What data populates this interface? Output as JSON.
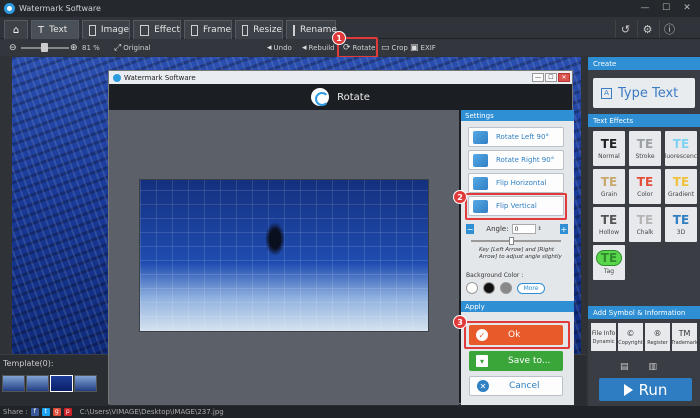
{
  "window": {
    "title": "Watermark Software"
  },
  "tabs": [
    {
      "label": "Text"
    },
    {
      "label": "Image"
    },
    {
      "label": "Effect"
    },
    {
      "label": "Frame"
    },
    {
      "label": "Resize"
    },
    {
      "label": "Rename"
    }
  ],
  "toolbar": {
    "zoom_value": "81 %",
    "original_label": "Original",
    "undo_label": "Undo",
    "rebuild_label": "Rebuild",
    "rotate_label": "Rotate",
    "crop_label": "Crop",
    "exif_label": "EXIF"
  },
  "template": {
    "label": "Template(0):"
  },
  "status": {
    "share_label": "Share :",
    "file_path": "C:\\Users\\VIMAGE\\Desktop\\IMAGE\\237.jpg"
  },
  "right_panel": {
    "create_header": "Create",
    "type_text_label": "Type Text",
    "text_effects_header": "Text Effects",
    "effects": [
      {
        "glyph": "TE",
        "name": "Normal",
        "color": "#222222"
      },
      {
        "glyph": "TE",
        "name": "Stroke",
        "color": "#9aa0a6"
      },
      {
        "glyph": "TE",
        "name": "Fluorescence",
        "color": "#7fd3f2"
      },
      {
        "glyph": "TE",
        "name": "Grain",
        "color": "#c9a96b"
      },
      {
        "glyph": "TE",
        "name": "Color",
        "color": "#e2503c"
      },
      {
        "glyph": "TE",
        "name": "Gradient",
        "color": "#f0c23a"
      },
      {
        "glyph": "TE",
        "name": "Hollow",
        "color": "#555555"
      },
      {
        "glyph": "TE",
        "name": "Chalk",
        "color": "#b5b5b5"
      },
      {
        "glyph": "TE",
        "name": "3D",
        "color": "#2f7fc3"
      },
      {
        "glyph": "TE",
        "name": "Tag",
        "color": "#2e8b2e"
      }
    ],
    "symbol_header": "Add Symbol & Information",
    "symbols": [
      {
        "glyph": "File Info",
        "name": "Dynamic"
      },
      {
        "glyph": "©",
        "name": "Copyright"
      },
      {
        "glyph": "®",
        "name": "Register"
      },
      {
        "glyph": "TM",
        "name": "Trademark"
      }
    ],
    "run_label": "Run"
  },
  "dialog": {
    "title": "Watermark Software",
    "header": "Rotate",
    "settings_header": "Settings",
    "rotate_left": "Rotate Left 90°",
    "rotate_right": "Rotate Right 90°",
    "flip_horizontal": "Flip Horizontal",
    "flip_vertical": "Flip Vertical",
    "angle_label": "Angle:",
    "angle_value": "0",
    "hint": "Key [Left Arrow] and [Right Arrow] to adjust angle slightly",
    "bg_color_label": "Background Color :",
    "more_label": "More",
    "apply_header": "Apply",
    "ok_label": "Ok",
    "save_label": "Save to...",
    "cancel_label": "Cancel"
  },
  "steps": [
    "1",
    "2",
    "3"
  ],
  "colors": {
    "accent": "#2f8fd4",
    "highlight": "#e03a3a",
    "ok": "#e85a2a",
    "save": "#3aa63a",
    "run": "#2e7dc2"
  }
}
